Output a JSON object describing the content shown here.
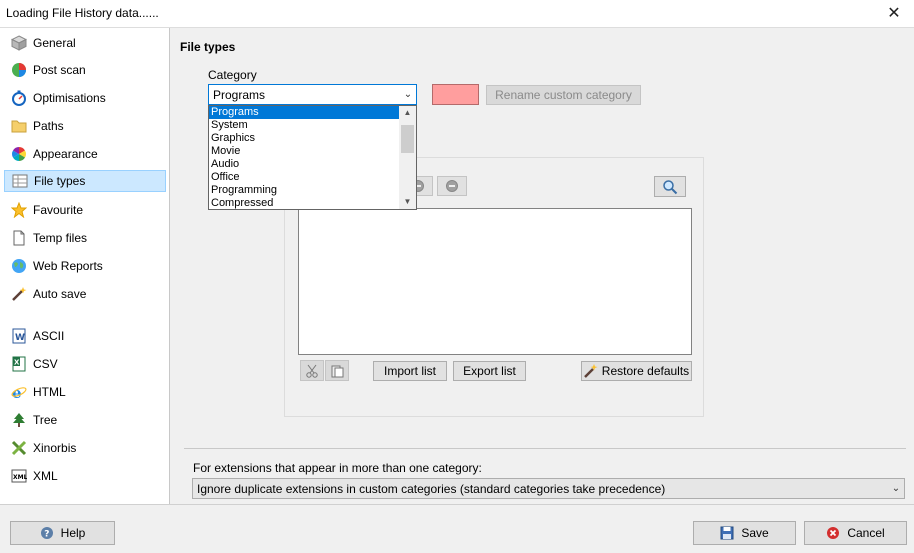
{
  "window": {
    "title": "Loading File History data......",
    "close_glyph": "✕"
  },
  "sidebar": {
    "items": [
      {
        "label": "General",
        "icon": "cube-icon"
      },
      {
        "label": "Post scan",
        "icon": "pie-chart-icon"
      },
      {
        "label": "Optimisations",
        "icon": "stopwatch-icon"
      },
      {
        "label": "Paths",
        "icon": "folder-icon"
      },
      {
        "label": "Appearance",
        "icon": "color-wheel-icon"
      },
      {
        "label": "File types",
        "icon": "table-icon",
        "selected": true
      },
      {
        "label": "Favourite",
        "icon": "star-icon"
      },
      {
        "label": "Temp files",
        "icon": "document-icon"
      },
      {
        "label": "Web Reports",
        "icon": "globe-icon"
      },
      {
        "label": "Auto save",
        "icon": "magic-wand-icon"
      },
      {
        "label": "ASCII",
        "icon": "word-doc-icon"
      },
      {
        "label": "CSV",
        "icon": "excel-icon"
      },
      {
        "label": "HTML",
        "icon": "internet-explorer-icon"
      },
      {
        "label": "Tree",
        "icon": "tree-icon"
      },
      {
        "label": "Xinorbis",
        "icon": "xinorbis-icon"
      },
      {
        "label": "XML",
        "icon": "xml-icon"
      }
    ]
  },
  "main": {
    "section_title": "File types",
    "category_label": "Category",
    "category_value": "Programs",
    "rename_button": "Rename custom category",
    "category_options": [
      "Programs",
      "System",
      "Graphics",
      "Movie",
      "Audio",
      "Office",
      "Programming",
      "Compressed"
    ],
    "import_button": "Import list",
    "export_button": "Export list",
    "restore_button": "Restore defaults",
    "duplicate_label": "For extensions that appear in more than one category:",
    "duplicate_value": "Ignore duplicate extensions in custom categories (standard categories take precedence)",
    "swatch_color": "#ff9e9e"
  },
  "footer": {
    "help": "Help",
    "save": "Save",
    "cancel": "Cancel"
  },
  "dropdown_arrow": "⌄"
}
